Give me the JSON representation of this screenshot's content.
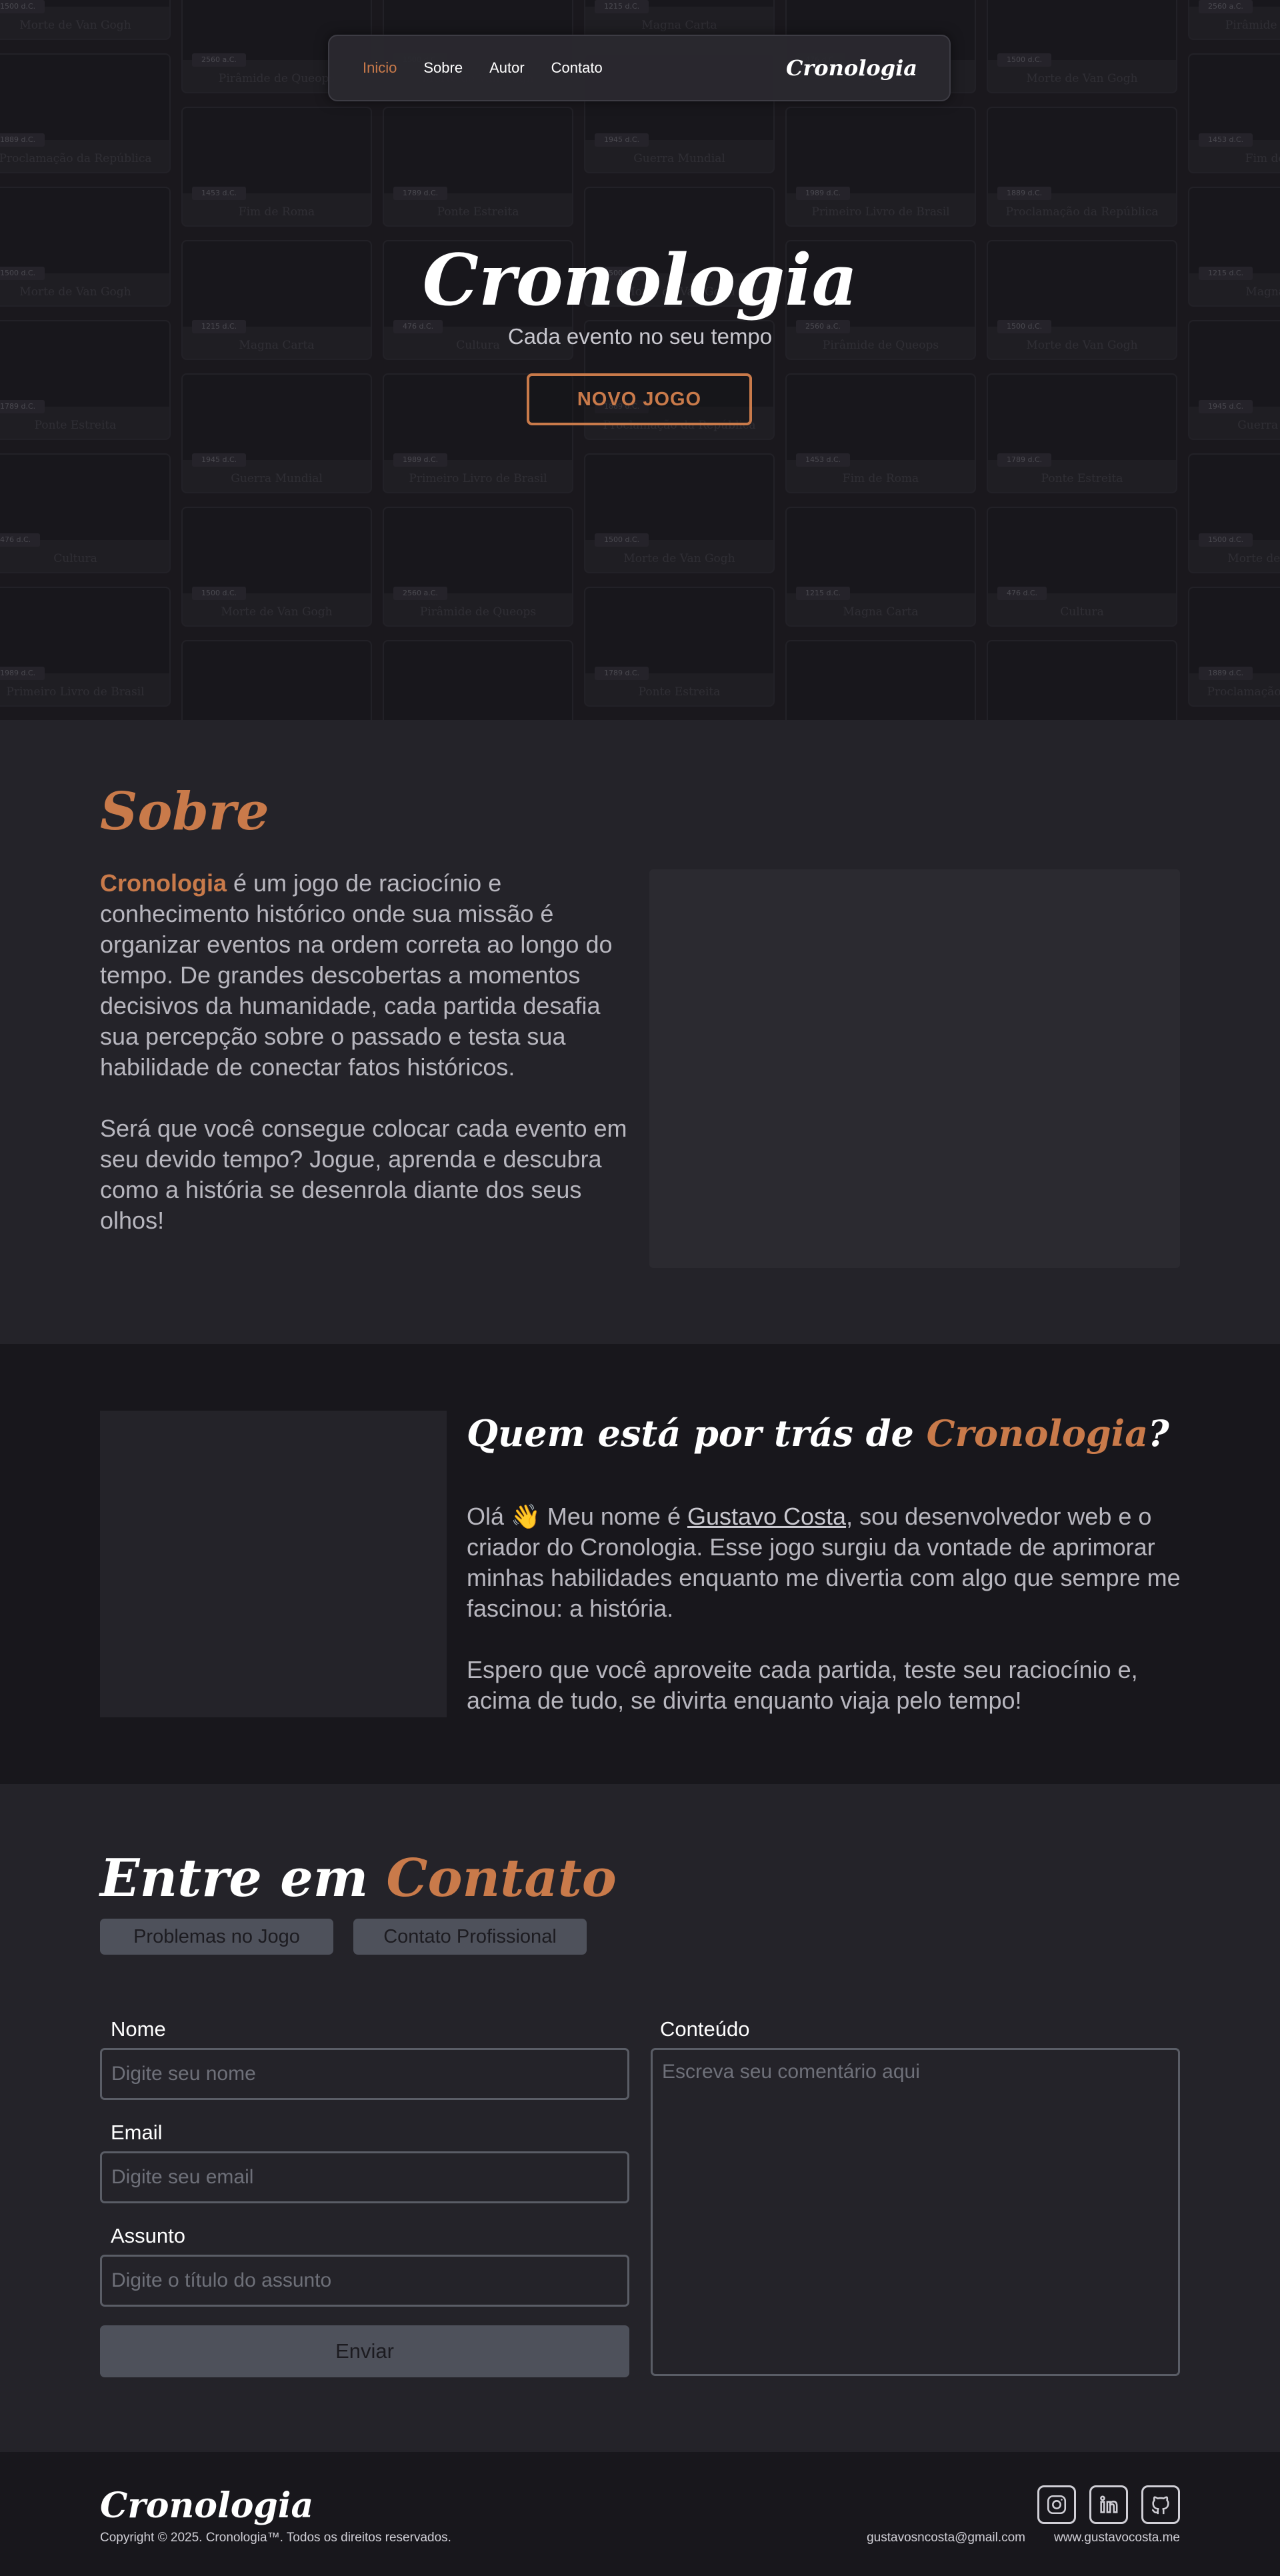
{
  "nav": {
    "links": [
      {
        "label": "Inicio"
      },
      {
        "label": "Sobre"
      },
      {
        "label": "Autor"
      },
      {
        "label": "Contato"
      }
    ],
    "brand": "Cronologia"
  },
  "hero": {
    "title": "Cronologia",
    "subtitle": "Cada evento no seu tempo",
    "button": "NOVO JOGO",
    "mosaic_cards": [
      {
        "tag": "1500 d.C.",
        "title": "Morte de Van Gogh"
      },
      {
        "tag": "1889 d.C.",
        "title": "Proclamação da República"
      },
      {
        "tag": "1500 d.C.",
        "title": "Morte de Van Gogh"
      },
      {
        "tag": "1789 d.C.",
        "title": "Ponte Estreita"
      },
      {
        "tag": "476 d.C.",
        "title": "Cultura"
      },
      {
        "tag": "1989 d.C.",
        "title": "Primeiro Livro de Brasil"
      },
      {
        "tag": "2560 a.C.",
        "title": "Pirâmide de Queops"
      },
      {
        "tag": "1453 d.C.",
        "title": "Fim de Roma"
      },
      {
        "tag": "1215 d.C.",
        "title": "Magna Carta"
      },
      {
        "tag": "1945 d.C.",
        "title": "Guerra Mundial"
      }
    ]
  },
  "sobre": {
    "title": "Sobre",
    "highlight": "Cronologia",
    "paragraph1": " é um jogo de raciocínio e conhecimento histórico onde sua missão é organizar eventos na ordem correta ao longo do tempo. De grandes descobertas a momentos decisivos da humanidade, cada partida desafia sua percepção sobre o passado e testa sua habilidade de conectar fatos históricos.",
    "paragraph2": "Será que você consegue colocar cada evento em seu devido tempo? Jogue, aprenda e descubra como a história se desenrola diante dos seus olhos!"
  },
  "autor": {
    "title_prefix": "Quem está por trás de ",
    "title_highlight": "Cronologia",
    "title_suffix": "?",
    "p1_before": "Olá 👋 Meu nome é ",
    "p1_link": "Gustavo Costa",
    "p1_after": ", sou desenvolvedor web e o criador do Cronologia. Esse jogo surgiu da vontade de aprimorar minhas habilidades enquanto me divertia com algo que sempre me fascinou: a história.",
    "paragraph2": "Espero que você aproveite cada partida, teste seu raciocínio e, acima de tudo, se divirta enquanto viaja pelo tempo!"
  },
  "contato": {
    "title_prefix": "Entre em ",
    "title_highlight": "Contato",
    "tabs": [
      "Problemas no Jogo",
      "Contato Profissional"
    ],
    "fields": {
      "nome_label": "Nome",
      "nome_placeholder": "Digite seu nome",
      "email_label": "Email",
      "email_placeholder": "Digite seu email",
      "assunto_label": "Assunto",
      "assunto_placeholder": "Digite o título do assunto",
      "conteudo_label": "Conteúdo",
      "conteudo_placeholder": "Escreva seu comentário aqui"
    },
    "submit": "Enviar"
  },
  "footer": {
    "brand": "Cronologia",
    "copyright": "Copyright © 2025. Cronologia™. Todos os direitos reservados.",
    "email": "gustavosncosta@gmail.com",
    "site": "www.gustavocosta.me",
    "social_icons": [
      "instagram-icon",
      "linkedin-icon",
      "github-icon"
    ]
  },
  "colors": {
    "accent": "#c97a4a",
    "background": "#242329",
    "background_dark": "#18171c",
    "button_gray": "#4e515b"
  }
}
